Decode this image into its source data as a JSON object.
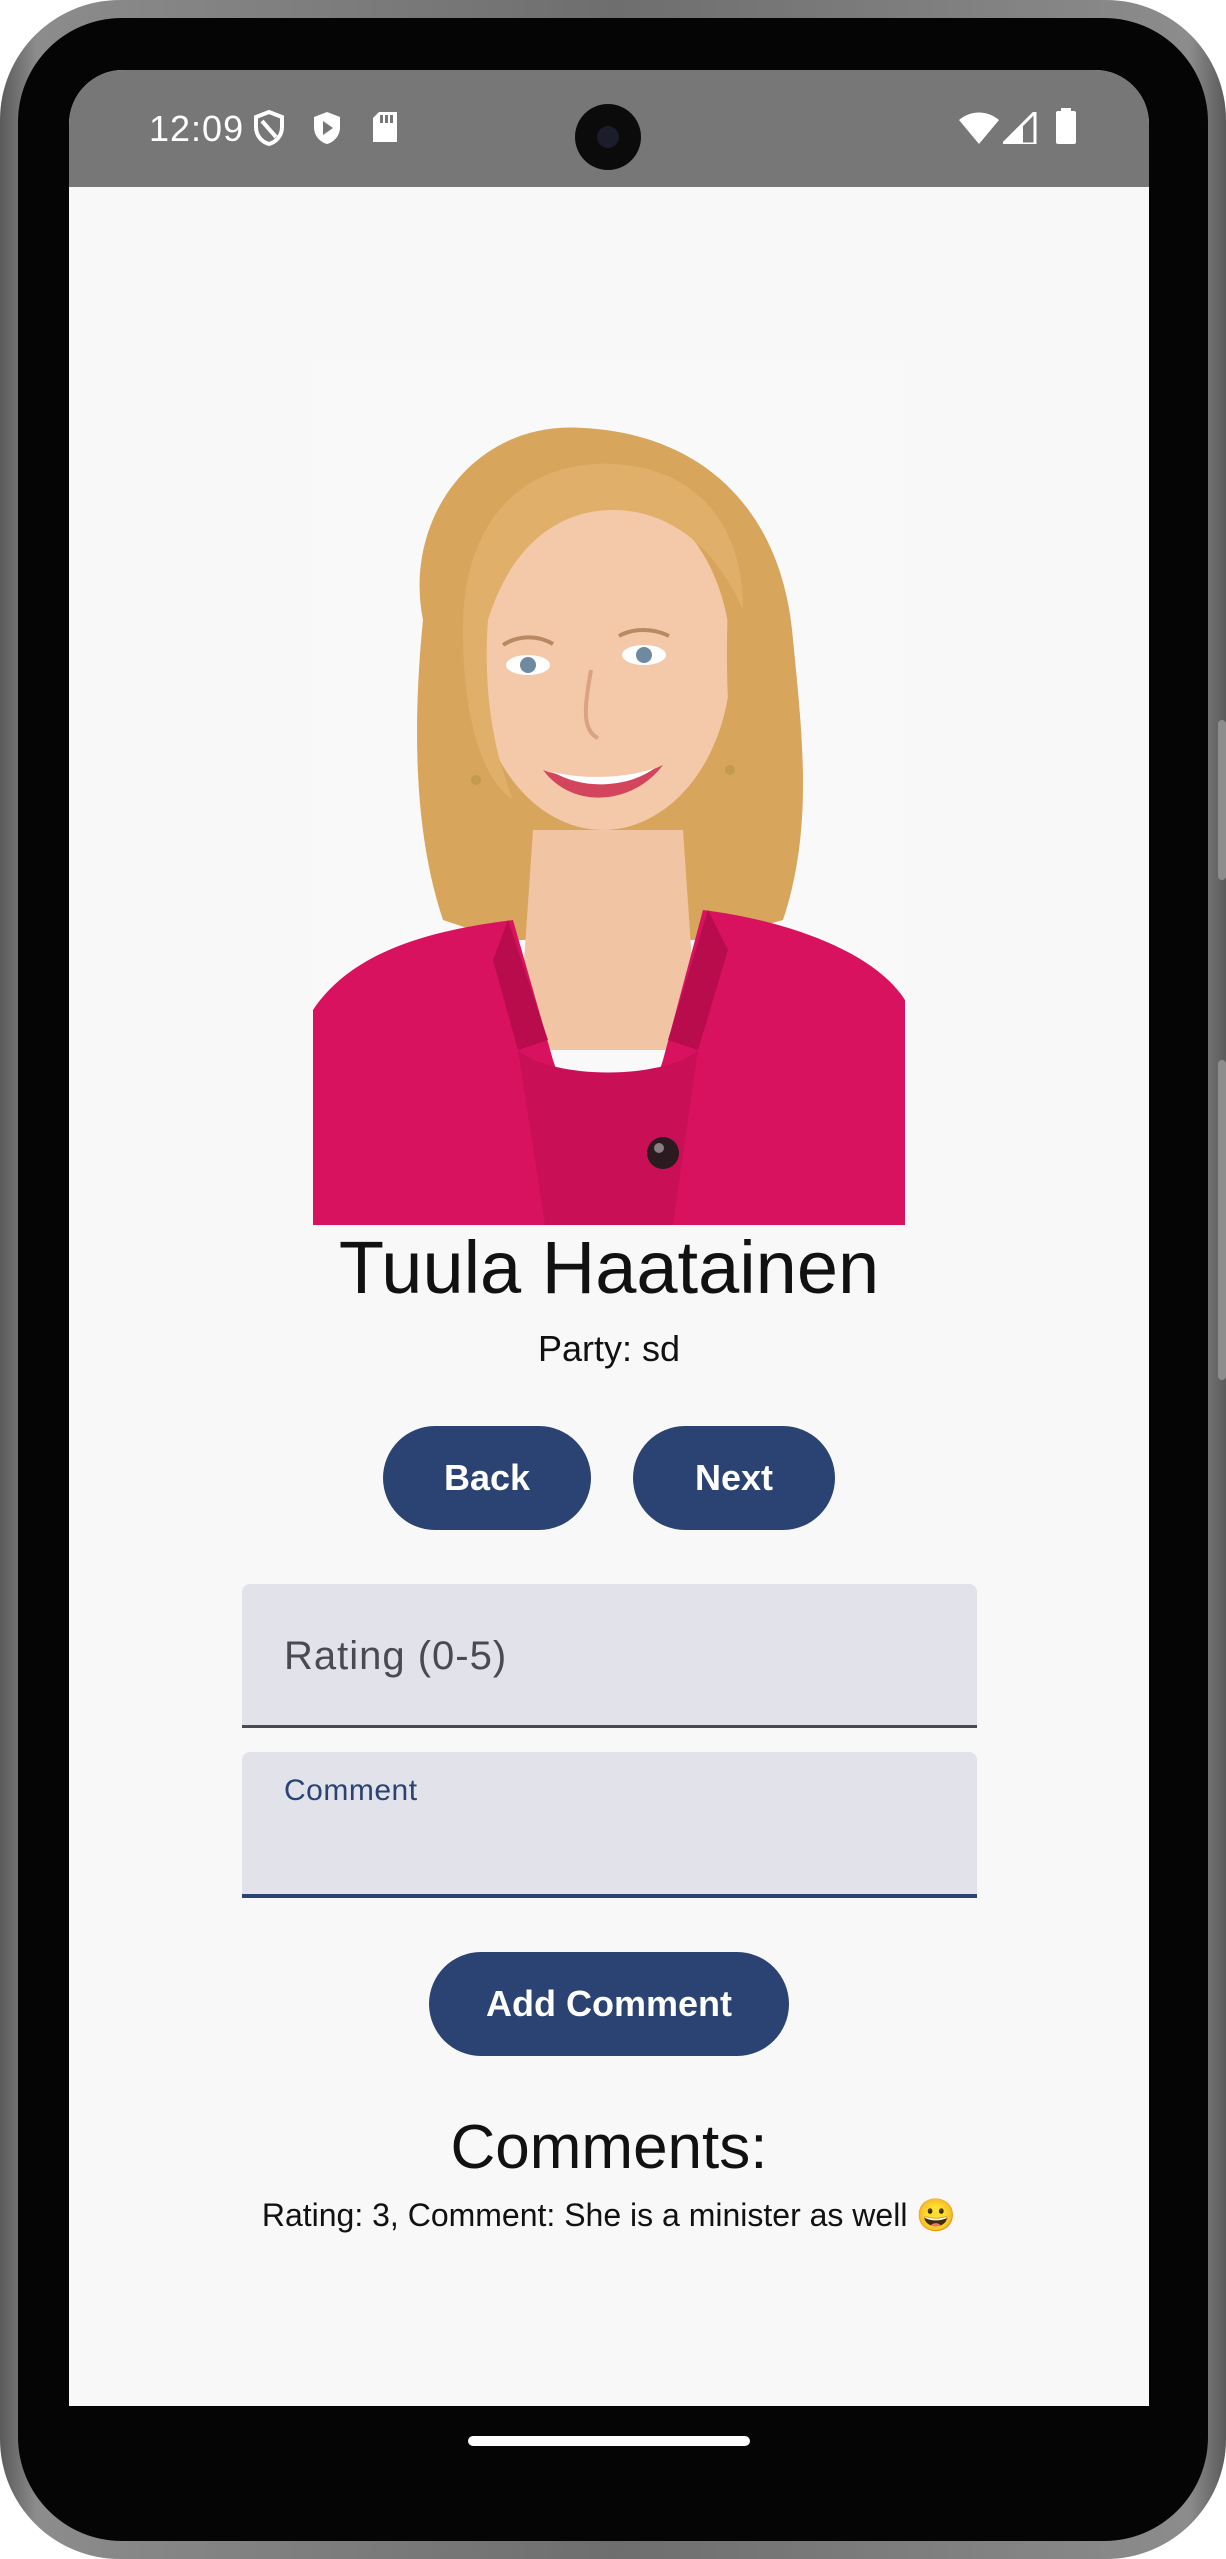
{
  "status_bar": {
    "time": "12:09",
    "left_icons": [
      "shield-icon",
      "play-shield-icon",
      "sd-card-icon"
    ],
    "right_icons": [
      "wifi-icon",
      "signal-icon",
      "battery-icon"
    ]
  },
  "profile": {
    "photo_alt": "portrait-photo",
    "name": "Tuula Haatainen",
    "party": "Party: sd"
  },
  "navigation": {
    "back_label": "Back",
    "next_label": "Next"
  },
  "form": {
    "rating_placeholder": "Rating (0-5)",
    "rating_value": "",
    "comment_label": "Comment",
    "comment_value": "",
    "add_comment_label": "Add Comment"
  },
  "comments": {
    "title": "Comments:",
    "items": [
      "Rating: 3, Comment: She is a minister as well 😀"
    ]
  },
  "colors": {
    "primary": "#2a4372",
    "status_bar": "#777777",
    "field_bg": "#e1e2ea",
    "jacket": "#d8125e"
  }
}
